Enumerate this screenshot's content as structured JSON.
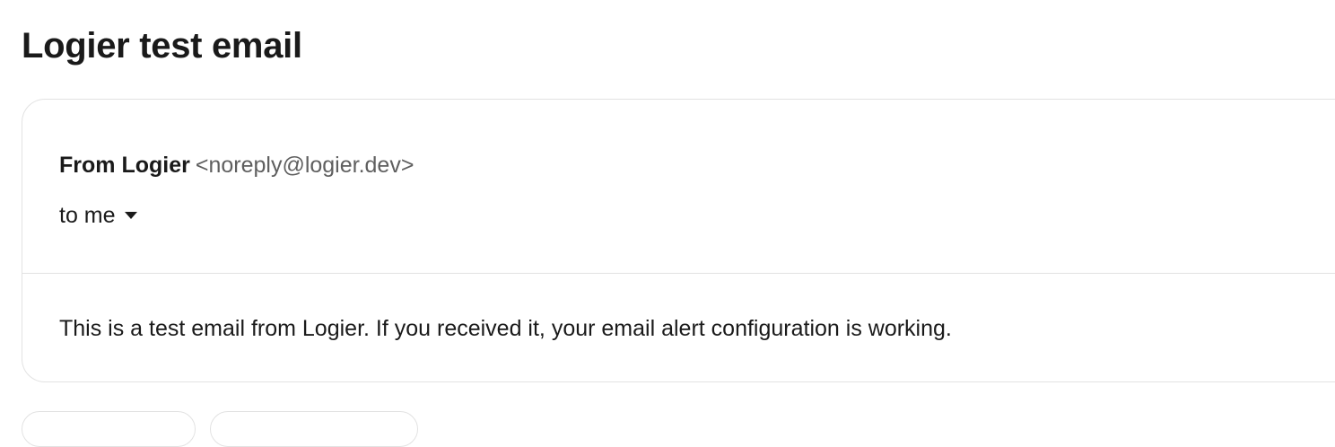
{
  "email": {
    "subject": "Logier test email",
    "from_label": "From Logier",
    "from_address": "<noreply@logier.dev>",
    "recipient_label": "to me",
    "body": "This is a test email from Logier. If you received it, your email alert configuration is working."
  }
}
